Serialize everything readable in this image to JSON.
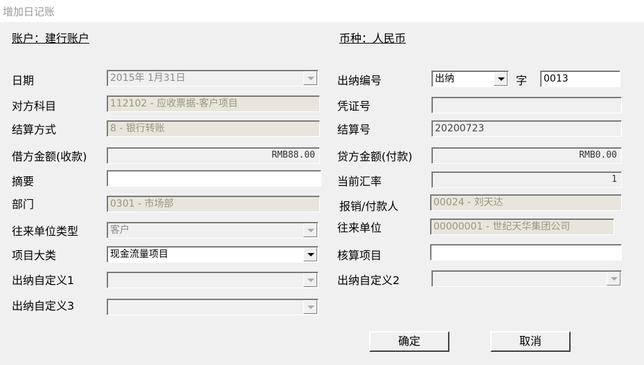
{
  "window": {
    "title": "增加日记账"
  },
  "header": {
    "account": "账户：建行账户",
    "currency": "币种：人民币"
  },
  "labels": {
    "date": "日期",
    "counter_subject": "对方科目",
    "settle_method": "结算方式",
    "debit": "借方金额(收款)",
    "summary": "摘要",
    "dept": "部门",
    "partner_type": "往来单位类型",
    "project_class": "项目大类",
    "custom1": "出纳自定义1",
    "custom3": "出纳自定义3",
    "cashier_no": "出纳编号",
    "zi": "字",
    "voucher_no": "凭证号",
    "settle_no": "结算号",
    "credit": "贷方金额(付款)",
    "rate": "当前汇率",
    "payer": "报销/付款人",
    "partner": "往来单位",
    "accounting_item": "核算项目",
    "custom2": "出纳自定义2"
  },
  "values": {
    "date": "2015年 1月31日",
    "counter_subject": "112102 - 应收票据-客户项目",
    "settle_method": "8 - 银行转账",
    "debit": "RMB88.00",
    "summary": "",
    "dept": "0301 - 市场部",
    "partner_type": "客户",
    "project_class": "现金流量项目",
    "custom1": "",
    "custom3": "",
    "cashier_type": "出纳",
    "cashier_num": "0013",
    "voucher_no": "",
    "settle_no": "20200723",
    "credit": "RMB0.00",
    "rate": "1",
    "payer": "00024 - 刘天达",
    "partner": "00000001 - 世纪天华集团公司",
    "accounting_item": "",
    "custom2": ""
  },
  "buttons": {
    "ok": "确定",
    "cancel": "取消"
  }
}
